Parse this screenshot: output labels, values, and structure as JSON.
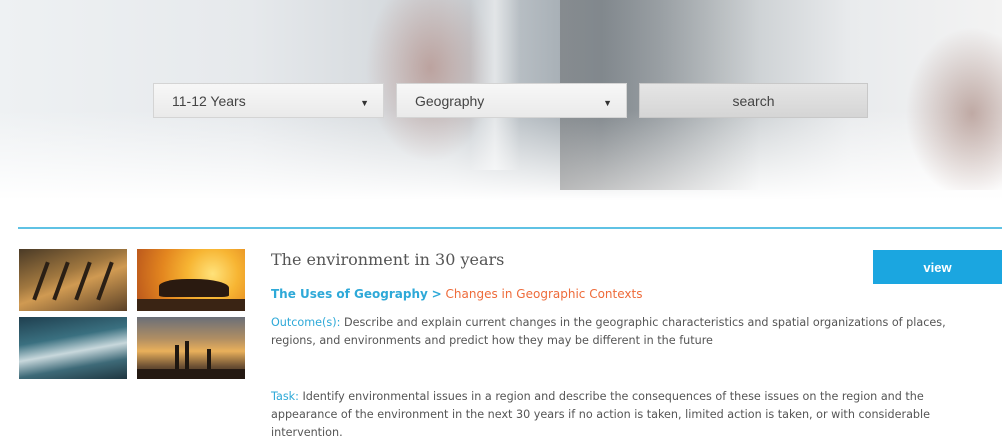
{
  "filters": {
    "age": {
      "selected": "11-12 Years",
      "icon": "caret-down-icon"
    },
    "subject": {
      "selected": "Geography",
      "icon": "caret-down-icon"
    },
    "search_label": "search"
  },
  "colors": {
    "accent": "#2ea9d8",
    "view_button": "#1ba6e0",
    "breadcrumb_current": "#ee6b3a",
    "divider": "#5fc2e4"
  },
  "result": {
    "title": "The environment in 30 years",
    "breadcrumb": {
      "parent": "The Uses of Geography",
      "separator": ">",
      "current": "Changes in Geographic Contexts"
    },
    "outcome_label": "Outcome(s):",
    "outcome_text": "Describe and explain current changes in the geographic characteristics and spatial organizations of places, regions, and environments and predict how they may be different in the future",
    "task_label": "Task:",
    "task_text": "Identify environmental issues in a region and describe the consequences of these issues on the region and the appearance of the environment in the next 30 years if no action is taken, limited action is taken, or with considerable intervention.",
    "view_label": "view"
  }
}
